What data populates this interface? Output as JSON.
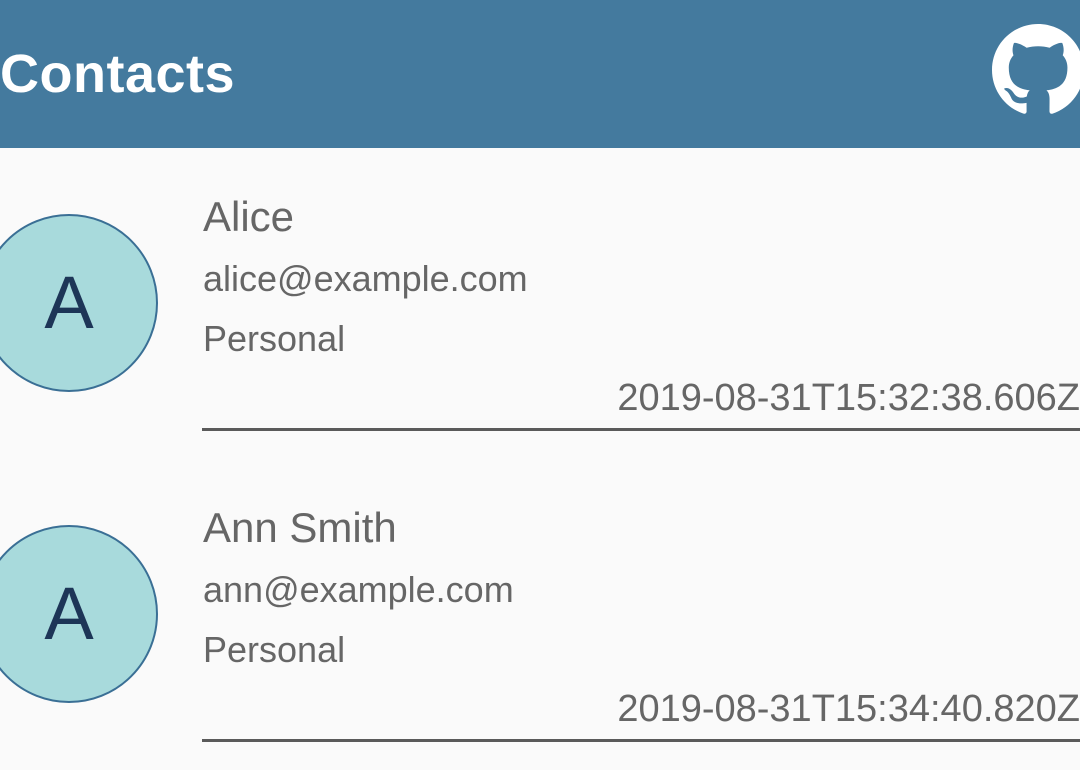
{
  "app_bar": {
    "title": "Contacts",
    "github_icon": "github-icon",
    "background_color": "#447a9e"
  },
  "contacts": [
    {
      "initial": "A",
      "name": "Alice",
      "email": "alice@example.com",
      "category": "Personal",
      "timestamp": "2019-08-31T15:32:38.606Z"
    },
    {
      "initial": "A",
      "name": "Ann Smith",
      "email": "ann@example.com",
      "category": "Personal",
      "timestamp": "2019-08-31T15:34:40.820Z"
    }
  ],
  "colors": {
    "avatar_fill": "#a8dadc",
    "avatar_border": "#3a6f95",
    "avatar_text": "#1d3557",
    "text_secondary": "#666666"
  }
}
